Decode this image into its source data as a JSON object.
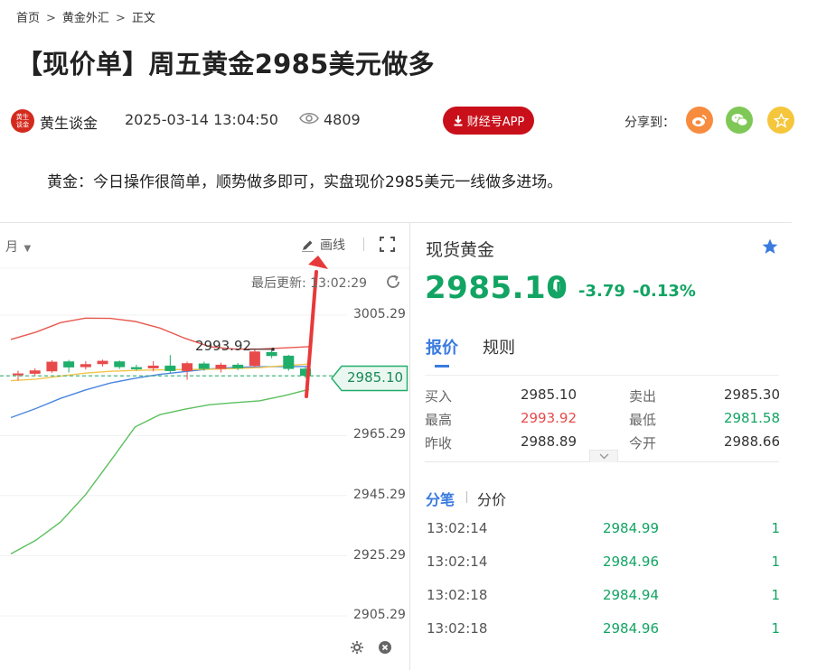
{
  "breadcrumb": {
    "items": [
      "首页",
      "黄金外汇",
      "正文"
    ],
    "separator": ">"
  },
  "article": {
    "title": "【现价单】周五黄金2985美元做多",
    "author": "黄生谈金",
    "avatar_text": "黄生谈金",
    "publish_time": "2025-03-14 13:04:50",
    "view_count": "4809",
    "app_button_label": "财经号APP",
    "share_label": "分享到：",
    "paragraph": "黄金：今日操作很简单，顺势做多即可，实盘现价2985美元一线做多进场。"
  },
  "chart_toolbar": {
    "period_label": "月",
    "draw_line_label": "画线",
    "last_update": "最后更新: 13:02:29"
  },
  "chart_data": {
    "type": "candlestick",
    "y_ticks": [
      "3005.29",
      "2965.29",
      "2945.29",
      "2925.29",
      "2905.29"
    ],
    "ylim": [
      2895,
      3015
    ],
    "high_annotation": "2993.92",
    "current_price_tag": "2985.10",
    "candles": [
      {
        "o": 2985.3,
        "c": 2985.9,
        "h": 2986.8,
        "l": 2983.5
      },
      {
        "o": 2985.8,
        "c": 2986.9,
        "h": 2987.6,
        "l": 2985.0
      },
      {
        "o": 2986.6,
        "c": 2989.8,
        "h": 2990.3,
        "l": 2986.1
      },
      {
        "o": 2989.9,
        "c": 2987.9,
        "h": 2990.4,
        "l": 2986.2
      },
      {
        "o": 2988.0,
        "c": 2989.0,
        "h": 2990.0,
        "l": 2987.2
      },
      {
        "o": 2989.0,
        "c": 2990.1,
        "h": 2990.5,
        "l": 2988.2
      },
      {
        "o": 2989.9,
        "c": 2988.0,
        "h": 2990.2,
        "l": 2987.4
      },
      {
        "o": 2988.0,
        "c": 2987.3,
        "h": 2988.8,
        "l": 2986.8
      },
      {
        "o": 2987.6,
        "c": 2988.5,
        "h": 2990.0,
        "l": 2986.6
      },
      {
        "o": 2988.5,
        "c": 2986.7,
        "h": 2992.0,
        "l": 2986.1
      },
      {
        "o": 2986.7,
        "c": 2989.3,
        "h": 2989.8,
        "l": 2983.8
      },
      {
        "o": 2989.2,
        "c": 2987.4,
        "h": 2989.8,
        "l": 2986.8
      },
      {
        "o": 2987.4,
        "c": 2988.8,
        "h": 2989.5,
        "l": 2986.2
      },
      {
        "o": 2988.8,
        "c": 2987.6,
        "h": 2989.4,
        "l": 2987.0
      },
      {
        "o": 2988.4,
        "c": 2993.2,
        "h": 2993.9,
        "l": 2988.0
      },
      {
        "o": 2993.0,
        "c": 2991.7,
        "h": 2993.6,
        "l": 2991.0
      },
      {
        "o": 2991.8,
        "c": 2987.4,
        "h": 2992.1,
        "l": 2986.8
      },
      {
        "o": 2987.5,
        "c": 2985.1,
        "h": 2988.0,
        "l": 2984.4
      }
    ],
    "lines": {
      "upper_band": [
        2997.2,
        2999.6,
        3002.8,
        3004.3,
        3004.2,
        3003.2,
        3001.0,
        2997.6,
        2994.8,
        2994.0,
        2994.0,
        2994.4,
        2994.8
      ],
      "middle_band": [
        2971.2,
        2974.2,
        2977.6,
        2980.4,
        2982.7,
        2984.3,
        2985.6,
        2986.5,
        2987.4,
        2987.9,
        2988.1,
        2988.2,
        2988.2
      ],
      "lower_band": [
        2925.9,
        2930.4,
        2936.5,
        2945.5,
        2956.7,
        2968.1,
        2972.2,
        2974.0,
        2975.5,
        2976.2,
        2976.8,
        2978.5,
        2980.6
      ],
      "ma_short": [
        2983.5,
        2984.0,
        2985.0,
        2986.0,
        2986.6,
        2986.9,
        2987.1,
        2987.2,
        2987.3,
        2987.5,
        2987.8,
        2988.5,
        2989.0
      ]
    },
    "colors": {
      "up": "#e84a4a",
      "down": "#1fae6a",
      "upper_band": "#e8584f",
      "middle_band": "#4a86e0",
      "lower_band": "#5cc05f",
      "ma_short": "#f2c54b",
      "annotation_arrow": "#e8393a"
    }
  },
  "quote": {
    "name": "现货黄金",
    "price": "2985.10",
    "change": "-3.79",
    "change_pct": "-0.13%",
    "tabs": [
      "报价",
      "规则"
    ],
    "stats": [
      {
        "label": "买入",
        "value": "2985.10",
        "label2": "卖出",
        "value2": "2985.30"
      },
      {
        "label": "最高",
        "value": "2993.92",
        "label2": "最低",
        "value2": "2981.58"
      },
      {
        "label": "昨收",
        "value": "2988.89",
        "label2": "今开",
        "value2": "2988.66"
      }
    ],
    "subtabs": [
      "分笔",
      "分价"
    ],
    "ticks": [
      {
        "time": "13:02:14",
        "price": "2984.99",
        "vol": "1"
      },
      {
        "time": "13:02:14",
        "price": "2984.96",
        "vol": "1"
      },
      {
        "time": "13:02:18",
        "price": "2984.94",
        "vol": "1"
      },
      {
        "time": "13:02:18",
        "price": "2984.96",
        "vol": "1"
      }
    ],
    "colors": {
      "up": "#e84a4a",
      "down": "#12a463",
      "accent": "#3a7be0"
    }
  }
}
